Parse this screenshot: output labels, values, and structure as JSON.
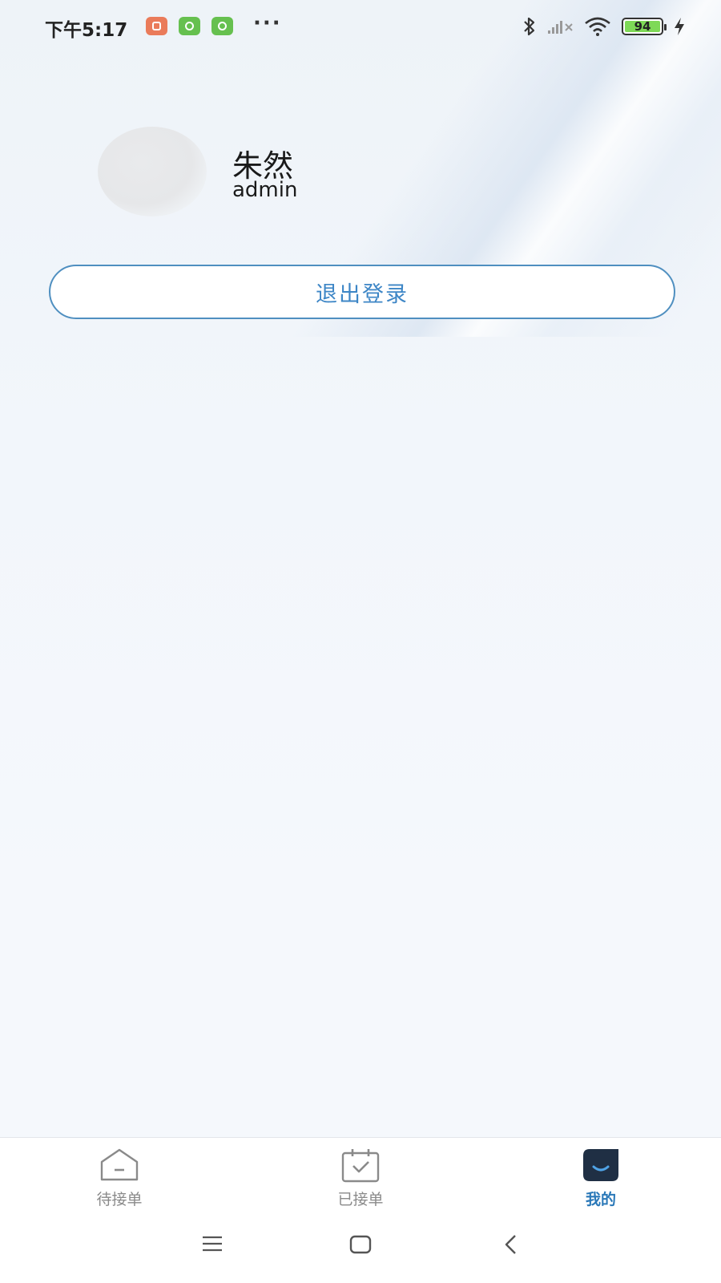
{
  "status_bar": {
    "time": "下午5:17",
    "more": "···",
    "battery": "94",
    "icons": [
      "app-notification-icon",
      "wechat-icon",
      "wechat-icon",
      "bluetooth-icon",
      "signal-icon",
      "wifi-icon",
      "battery-icon",
      "charging-icon"
    ]
  },
  "profile": {
    "name": "朱然",
    "account": "admin"
  },
  "logout_label": "退出登录",
  "tabs": [
    {
      "label": "待接单",
      "icon": "inbox-icon",
      "active": false
    },
    {
      "label": "已接单",
      "icon": "calendar-check-icon",
      "active": false
    },
    {
      "label": "我的",
      "icon": "profile-face-icon",
      "active": true
    }
  ],
  "nav_bar": [
    "menu-icon",
    "home-icon",
    "back-icon"
  ],
  "colors": {
    "accent": "#3d86c6",
    "active_tab": "#2a78b8",
    "inactive_tab": "#8a8a8a",
    "battery_fill": "#7ed957"
  }
}
